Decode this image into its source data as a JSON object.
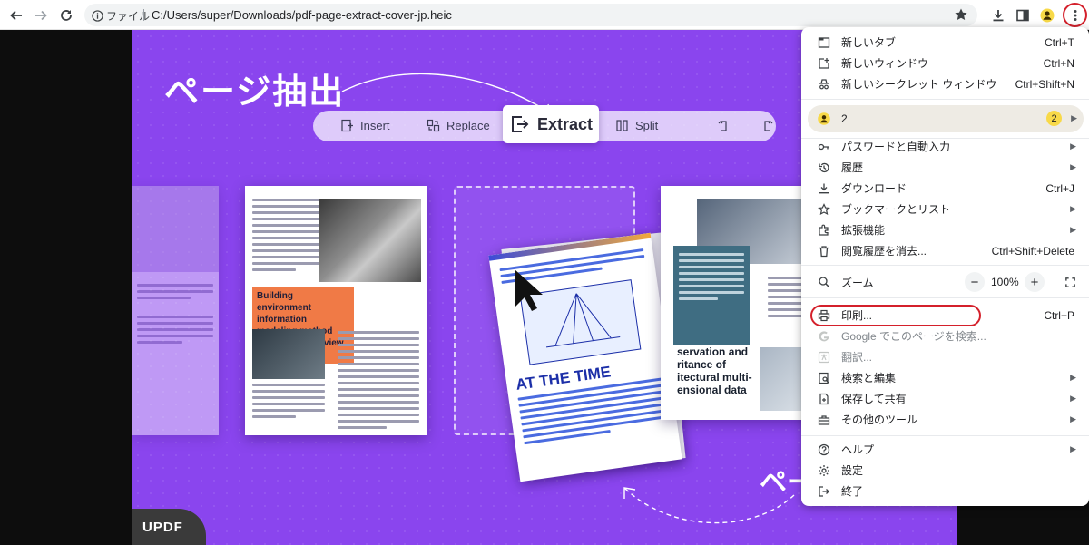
{
  "toolbar": {
    "info_label": "ファイル",
    "url": "C:/Users/super/Downloads/pdf-page-extract-cover-jp.heic"
  },
  "banner": {
    "title": "ページ抽出",
    "title_bottom": "ペー",
    "segments": [
      "Insert",
      "Replace",
      "Split"
    ],
    "active_segment": "Extract",
    "doc1_heading": "Building environment information modeling method based on multi-view image",
    "doc2_title": "AT THE TIME",
    "doc3_callout": "servation and ritance of itectural multi- ensional data",
    "logo": "UPDF"
  },
  "menu": {
    "items_top": [
      {
        "icon": "new-tab-icon",
        "label": "新しいタブ",
        "shortcut": "Ctrl+T"
      },
      {
        "icon": "new-window-icon",
        "label": "新しいウィンドウ",
        "shortcut": "Ctrl+N"
      },
      {
        "icon": "incognito-icon",
        "label": "新しいシークレット ウィンドウ",
        "shortcut": "Ctrl+Shift+N"
      }
    ],
    "profile": {
      "label": "2",
      "badge": "2"
    },
    "items_mid": [
      {
        "icon": "key-icon",
        "label": "パスワードと自動入力",
        "shortcut": "",
        "submenu": true
      },
      {
        "icon": "history-icon",
        "label": "履歴",
        "shortcut": "",
        "submenu": true
      },
      {
        "icon": "download-icon",
        "label": "ダウンロード",
        "shortcut": "Ctrl+J",
        "submenu": false
      },
      {
        "icon": "bookmark-icon",
        "label": "ブックマークとリスト",
        "shortcut": "",
        "submenu": true
      },
      {
        "icon": "extension-icon",
        "label": "拡張機能",
        "shortcut": "",
        "submenu": true
      },
      {
        "icon": "trash-icon",
        "label": "閲覧履歴を消去...",
        "shortcut": "Ctrl+Shift+Delete",
        "submenu": false
      }
    ],
    "zoom": {
      "label": "ズーム",
      "minus": "−",
      "value": "100%",
      "plus": "+"
    },
    "items_print": [
      {
        "icon": "print-icon",
        "label": "印刷...",
        "shortcut": "Ctrl+P",
        "submenu": false,
        "disabled": false
      },
      {
        "icon": "google-icon",
        "label": "Google でこのページを検索...",
        "shortcut": "",
        "submenu": false,
        "disabled": true
      },
      {
        "icon": "translate-icon",
        "label": "翻訳...",
        "shortcut": "",
        "submenu": false,
        "disabled": true
      },
      {
        "icon": "search-edit-icon",
        "label": "検索と編集",
        "shortcut": "",
        "submenu": true,
        "disabled": false
      },
      {
        "icon": "cast-save-icon",
        "label": "保存して共有",
        "shortcut": "",
        "submenu": true,
        "disabled": false
      },
      {
        "icon": "toolbox-icon",
        "label": "その他のツール",
        "shortcut": "",
        "submenu": true,
        "disabled": false
      }
    ],
    "items_bottom": [
      {
        "icon": "help-icon",
        "label": "ヘルプ",
        "shortcut": "",
        "submenu": true
      },
      {
        "icon": "settings-icon",
        "label": "設定",
        "shortcut": "",
        "submenu": false
      },
      {
        "icon": "exit-icon",
        "label": "終了",
        "shortcut": "",
        "submenu": false
      }
    ]
  },
  "colors": {
    "accent": "#8a45ee",
    "highlight_ring": "#d4202b"
  }
}
